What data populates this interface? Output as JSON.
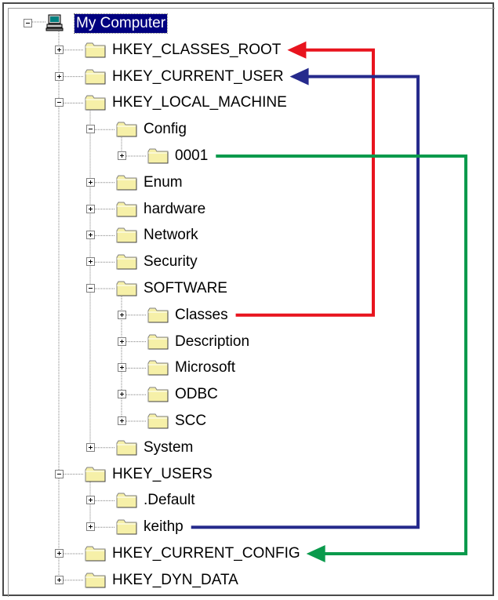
{
  "tree": {
    "root": {
      "label": "My Computer",
      "expanded": true,
      "selected": true,
      "icon": "computer-icon"
    },
    "nodes": [
      {
        "id": "hkcr",
        "label": "HKEY_CLASSES_ROOT",
        "expanded": false
      },
      {
        "id": "hkcu",
        "label": "HKEY_CURRENT_USER",
        "expanded": false
      },
      {
        "id": "hklm",
        "label": "HKEY_LOCAL_MACHINE",
        "expanded": true
      },
      {
        "id": "config",
        "label": "Config",
        "expanded": true
      },
      {
        "id": "c0001",
        "label": "0001",
        "expanded": false
      },
      {
        "id": "enum",
        "label": "Enum",
        "expanded": false
      },
      {
        "id": "hardware",
        "label": "hardware",
        "expanded": false
      },
      {
        "id": "network",
        "label": "Network",
        "expanded": false
      },
      {
        "id": "security",
        "label": "Security",
        "expanded": false
      },
      {
        "id": "software",
        "label": "SOFTWARE",
        "expanded": true
      },
      {
        "id": "classes",
        "label": "Classes",
        "expanded": false
      },
      {
        "id": "description",
        "label": "Description",
        "expanded": false
      },
      {
        "id": "microsoft",
        "label": "Microsoft",
        "expanded": false
      },
      {
        "id": "odbc",
        "label": "ODBC",
        "expanded": false
      },
      {
        "id": "scc",
        "label": "SCC",
        "expanded": false
      },
      {
        "id": "system",
        "label": "System",
        "expanded": false
      },
      {
        "id": "hku",
        "label": "HKEY_USERS",
        "expanded": true
      },
      {
        "id": "default",
        "label": ".Default",
        "expanded": false
      },
      {
        "id": "keithp",
        "label": "keithp",
        "expanded": false
      },
      {
        "id": "hkcc",
        "label": "HKEY_CURRENT_CONFIG",
        "expanded": false
      },
      {
        "id": "hkdd",
        "label": "HKEY_DYN_DATA",
        "expanded": false
      }
    ]
  },
  "arrows": [
    {
      "from": "classes",
      "to": "hkcr",
      "color": "#e8141e"
    },
    {
      "from": "keithp",
      "to": "hkcu",
      "color": "#262a8c"
    },
    {
      "from": "c0001",
      "to": "hkcc",
      "color": "#0a9a4c"
    }
  ],
  "colors": {
    "folder_fill": "#f6f0a8",
    "folder_stroke": "#808080",
    "selection": "#000080",
    "tree_line": "#808080"
  }
}
